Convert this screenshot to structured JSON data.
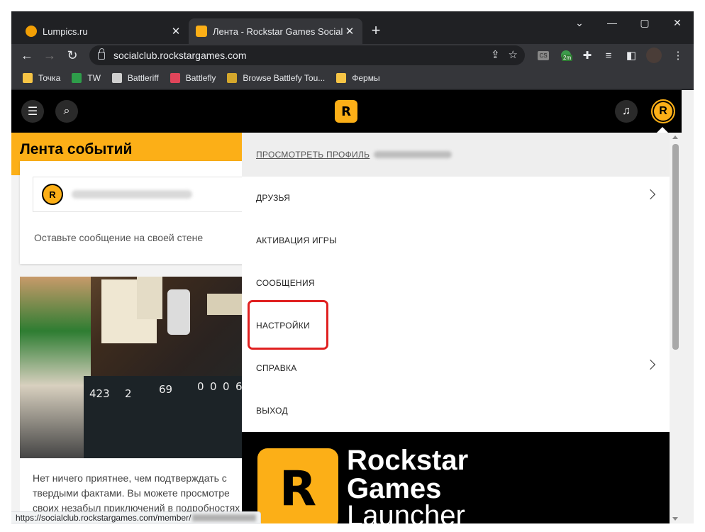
{
  "browser": {
    "tabs": [
      {
        "title": "Lumpics.ru",
        "favicon_color": "#f29f05"
      },
      {
        "title": "Лента - Rockstar Games Social Cl",
        "favicon_color": "#fcaf17"
      }
    ],
    "new_tab_label": "+",
    "window_controls": {
      "dropdown": "⌄",
      "minimize": "—",
      "maximize": "▢",
      "close": "✕"
    },
    "url": "socialclub.rockstargames.com",
    "extension_badge": "2m"
  },
  "bookmarks": [
    {
      "label": "Точка",
      "icon": "folder-icon",
      "color": "#f6c445"
    },
    {
      "label": "TW",
      "icon": "tw-icon",
      "color": "#2e9d4a"
    },
    {
      "label": "Battleriff",
      "icon": "battleriff-icon",
      "color": "#cfcfcf"
    },
    {
      "label": "Battlefly",
      "icon": "battlefly-icon",
      "color": "#e0455a"
    },
    {
      "label": "Browse Battlefy Tou...",
      "icon": "battlefy-icon",
      "color": "#d4a72c"
    },
    {
      "label": "Фермы",
      "icon": "folder-icon",
      "color": "#f6c445"
    }
  ],
  "site": {
    "logo_text": "R",
    "feed_title": "Лента событий",
    "wall_placeholder": "Оставьте сообщение на своей стене",
    "art_stats": [
      "423",
      "2",
      "69",
      "0",
      "0",
      "0",
      "6"
    ],
    "bottom_text_lines": [
      "Нет ничего приятнее, чем подтверждать с",
      "твердыми фактами. Вы можете просмотре",
      "своих незабыл приключений в подробностях"
    ]
  },
  "menu": {
    "profile_link": "ПРОСМОТРЕТЬ ПРОФИЛЬ",
    "items": [
      {
        "label": "ДРУЗЬЯ",
        "has_chevron": true
      },
      {
        "label": "АКТИВАЦИЯ ИГРЫ",
        "has_chevron": false
      },
      {
        "label": "СООБЩЕНИЯ",
        "has_chevron": false
      },
      {
        "label": "НАСТРОЙКИ",
        "has_chevron": false
      },
      {
        "label": "СПРАВКА",
        "has_chevron": true
      },
      {
        "label": "ВЫХОД",
        "has_chevron": false
      }
    ],
    "highlighted_item": "НАСТРОЙКИ",
    "launcher": {
      "line1": "Rockstar",
      "line2": "Games",
      "line3": "Launcher",
      "logo_letter": "R"
    }
  },
  "status_url": "https://socialclub.rockstargames.com/member/",
  "colors": {
    "brand_yellow": "#fcaf17",
    "highlight_red": "#e02020",
    "chrome_dark": "#202124",
    "chrome_toolbar": "#35363a"
  }
}
